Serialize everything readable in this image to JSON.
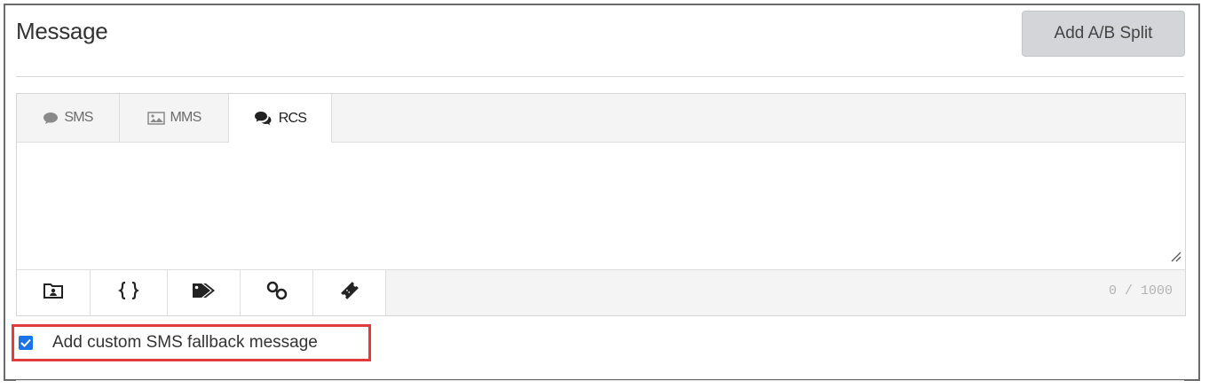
{
  "header": {
    "title": "Message",
    "ab_split_label": "Add A/B Split"
  },
  "tabs": [
    {
      "label": "SMS",
      "icon": "speech-bubble-icon",
      "active": false
    },
    {
      "label": "MMS",
      "icon": "image-icon",
      "active": false
    },
    {
      "label": "RCS",
      "icon": "chat-bubbles-icon",
      "active": true
    }
  ],
  "editor": {
    "value": ""
  },
  "toolbar": {
    "buttons": [
      "contact-card-icon",
      "braces-icon",
      "tag-icon",
      "link-icon",
      "ticket-icon"
    ],
    "counter": "0 / 1000"
  },
  "fallback": {
    "label": "Add custom SMS fallback message",
    "checked": true
  },
  "colors": {
    "highlight": "#e23b3b",
    "checkbox": "#1a73e8"
  }
}
